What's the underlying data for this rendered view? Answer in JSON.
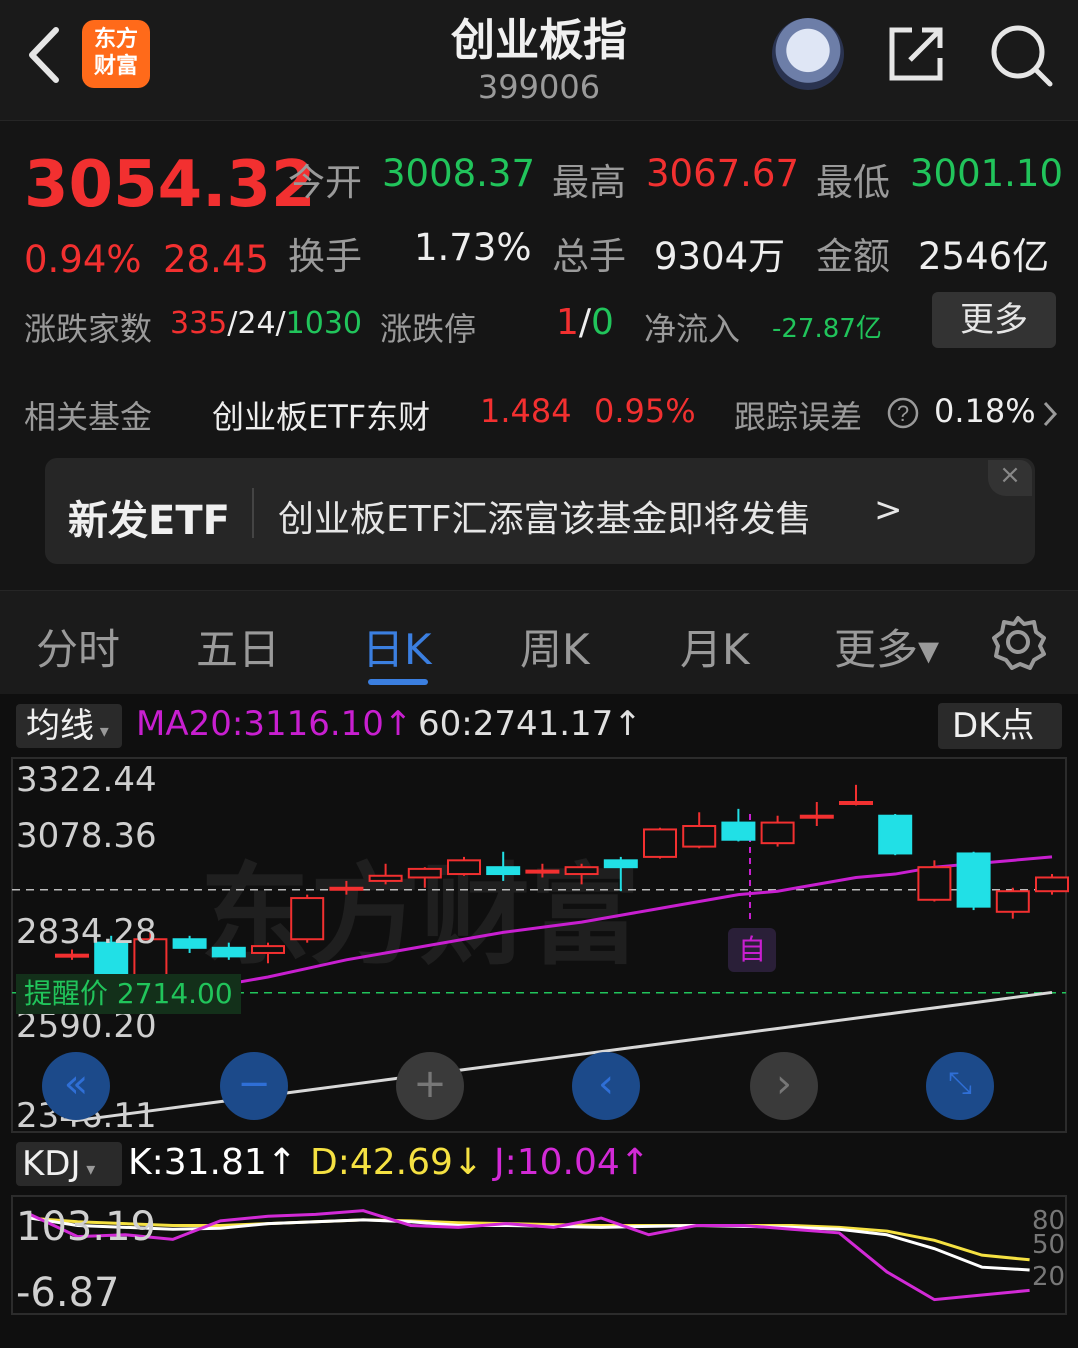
{
  "header": {
    "title": "创业板指",
    "code": "399006",
    "logo_text": "东方\n财富"
  },
  "quote": {
    "price": "3054.32",
    "change_pct": "0.94%",
    "change": "28.45",
    "open_label": "今开",
    "open": "3008.37",
    "high_label": "最高",
    "high": "3067.67",
    "low_label": "最低",
    "low": "3001.10",
    "turnover_label": "换手",
    "turnover": "1.73%",
    "volume_label": "总手",
    "volume": "9304万",
    "amount_label": "金额",
    "amount": "2546亿",
    "breadth_label": "涨跌家数",
    "breadth_up": "335",
    "breadth_flat": "/24/",
    "breadth_down": "1030",
    "limit_label": "涨跌停",
    "limit_up": "1",
    "limit_sep": "/",
    "limit_down": "0",
    "netflow_label": "净流入",
    "netflow": "-27.87亿",
    "more_label": "更多"
  },
  "fund": {
    "label": "相关基金",
    "name": "创业板ETF东财",
    "price": "1.484",
    "pct": "0.95%",
    "track_label": "跟踪误差",
    "track_value": "0.18%"
  },
  "banner": {
    "tag": "新发ETF",
    "text": "创业板ETF汇添富该基金即将发售",
    "arrow": ">",
    "close": "×"
  },
  "tabs": [
    {
      "label": "分时"
    },
    {
      "label": "五日"
    },
    {
      "label": "日K"
    },
    {
      "label": "周K"
    },
    {
      "label": "月K"
    },
    {
      "label": "更多▾"
    }
  ],
  "indicator": {
    "ma_label": "均线",
    "ma20": "MA20:3116.10↑",
    "ma60": "60:2741.17↑",
    "dk_label": "DK点",
    "alert_text": "提醒价 2714.00",
    "self_marker": "自",
    "watermark": "东方财富"
  },
  "kdj": {
    "label": "KDJ",
    "k": "K:31.81↑",
    "d": "D:42.69↓",
    "j": "J:10.04↑",
    "axis_top": "103.19",
    "axis_bottom": "-6.87",
    "r80": "80",
    "r50": "50",
    "r20": "20"
  },
  "colors": {
    "up": "#f23030",
    "down": "#21e0e6",
    "ma20": "#c81fd0",
    "ma60": "#d8d8d8",
    "k": "#ffffff",
    "d": "#f5e142",
    "j": "#d22ad6"
  },
  "chart_data": {
    "type": "candlestick",
    "y_ticks": [
      "3322.44",
      "3078.36",
      "2834.28",
      "2590.20",
      "2346.11"
    ],
    "ylim": [
      2346.11,
      3322.44
    ],
    "candles": [
      {
        "o": 2820,
        "c": 2825,
        "h": 2840,
        "l": 2810
      },
      {
        "o": 2860,
        "c": 2720,
        "h": 2880,
        "l": 2700
      },
      {
        "o": 2720,
        "c": 2870,
        "h": 2890,
        "l": 2710
      },
      {
        "o": 2870,
        "c": 2845,
        "h": 2880,
        "l": 2830
      },
      {
        "o": 2845,
        "c": 2820,
        "h": 2860,
        "l": 2810
      },
      {
        "o": 2830,
        "c": 2850,
        "h": 2860,
        "l": 2800
      },
      {
        "o": 2870,
        "c": 2990,
        "h": 3000,
        "l": 2860
      },
      {
        "o": 3020,
        "c": 3020,
        "h": 3040,
        "l": 3000
      },
      {
        "o": 3040,
        "c": 3055,
        "h": 3090,
        "l": 3030
      },
      {
        "o": 3050,
        "c": 3075,
        "h": 3080,
        "l": 3020
      },
      {
        "o": 3060,
        "c": 3100,
        "h": 3110,
        "l": 3055
      },
      {
        "o": 3080,
        "c": 3060,
        "h": 3125,
        "l": 3040
      },
      {
        "o": 3070,
        "c": 3070,
        "h": 3090,
        "l": 3050
      },
      {
        "o": 3060,
        "c": 3080,
        "h": 3090,
        "l": 3030
      },
      {
        "o": 3100,
        "c": 3080,
        "h": 3110,
        "l": 3010
      },
      {
        "o": 3110,
        "c": 3190,
        "h": 3195,
        "l": 3105
      },
      {
        "o": 3140,
        "c": 3200,
        "h": 3240,
        "l": 3135
      },
      {
        "o": 3210,
        "c": 3160,
        "h": 3250,
        "l": 3155
      },
      {
        "o": 3150,
        "c": 3210,
        "h": 3230,
        "l": 3140
      },
      {
        "o": 3230,
        "c": 3230,
        "h": 3270,
        "l": 3200
      },
      {
        "o": 3265,
        "c": 3270,
        "h": 3320,
        "l": 3260
      },
      {
        "o": 3230,
        "c": 3120,
        "h": 3235,
        "l": 3115
      },
      {
        "o": 2985,
        "c": 3080,
        "h": 3100,
        "l": 2980
      },
      {
        "o": 3120,
        "c": 2965,
        "h": 3125,
        "l": 2955
      },
      {
        "o": 2950,
        "c": 3010,
        "h": 3020,
        "l": 2930
      },
      {
        "o": 3010,
        "c": 3050,
        "h": 3060,
        "l": 3000
      }
    ],
    "ma20": [
      2680,
      2690,
      2705,
      2720,
      2740,
      2760,
      2785,
      2810,
      2830,
      2850,
      2870,
      2890,
      2905,
      2920,
      2940,
      2960,
      2980,
      3000,
      3010,
      3030,
      3050,
      3060,
      3080,
      3090,
      3100,
      3110
    ],
    "ma60": [
      2340,
      2355,
      2370,
      2385,
      2400,
      2415,
      2430,
      2445,
      2460,
      2475,
      2490,
      2505,
      2520,
      2535,
      2550,
      2565,
      2580,
      2595,
      2610,
      2625,
      2640,
      2655,
      2670,
      2685,
      2700,
      2715
    ],
    "alert_price": 2714.0,
    "kdj_lines": {
      "k": [
        88,
        80,
        78,
        76,
        77,
        82,
        84,
        86,
        84,
        80,
        80,
        79,
        78,
        79,
        80,
        79,
        78,
        76,
        70,
        55,
        35,
        32
      ],
      "d": [
        88,
        84,
        82,
        80,
        80,
        82,
        84,
        86,
        85,
        83,
        82,
        81,
        80,
        80,
        80,
        80,
        80,
        78,
        74,
        64,
        48,
        43
      ],
      "j": [
        92,
        68,
        70,
        65,
        85,
        90,
        92,
        96,
        80,
        78,
        82,
        78,
        88,
        70,
        80,
        80,
        76,
        72,
        30,
        0,
        5,
        10
      ]
    }
  }
}
